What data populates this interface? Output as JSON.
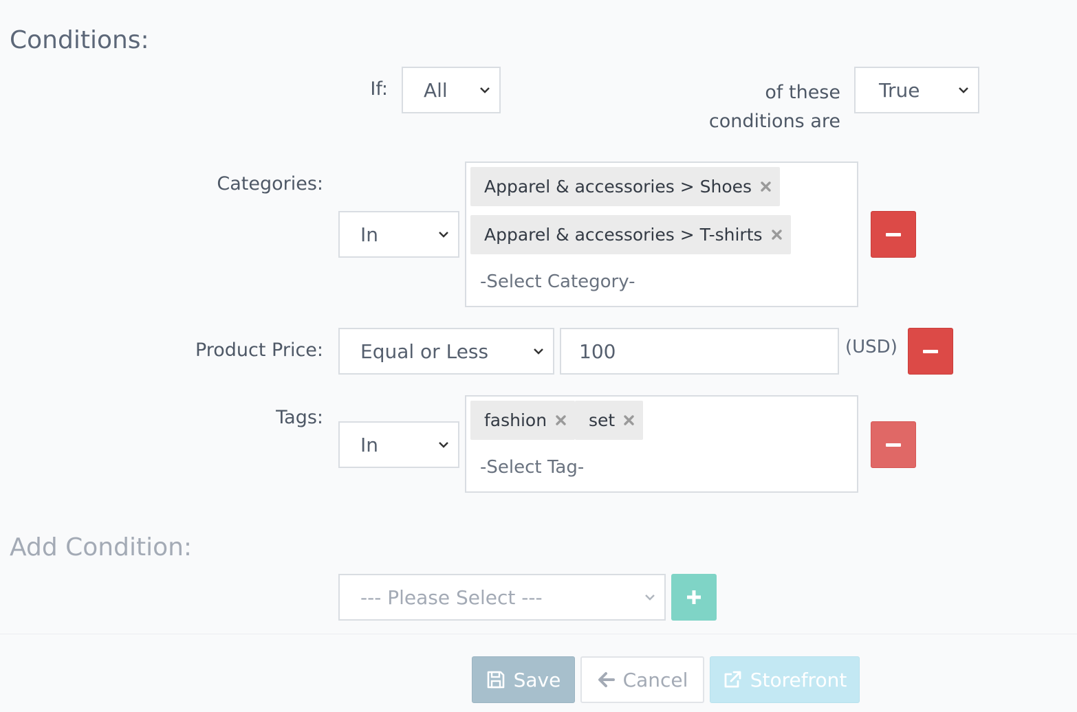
{
  "conditions_heading": "Conditions:",
  "if_row": {
    "if_label": "If:",
    "match_value": "All",
    "of_these_line1": "of these",
    "of_these_line2": "conditions are",
    "truth_value": "True"
  },
  "categories": {
    "label": "Categories:",
    "operator": "In",
    "chips": [
      "Apparel & accessories > Shoes",
      "Apparel & accessories > T-shirts"
    ],
    "placeholder": "-Select Category-"
  },
  "product_price": {
    "label": "Product Price:",
    "operator": "Equal or Less",
    "value": "100",
    "currency": "(USD)"
  },
  "tags": {
    "label": "Tags:",
    "operator": "In",
    "chips": [
      "fashion",
      "set"
    ],
    "placeholder": "-Select Tag-"
  },
  "add_condition": {
    "heading": "Add Condition:",
    "placeholder": "--- Please Select ---"
  },
  "actions": {
    "save": "Save",
    "cancel": "Cancel",
    "storefront": "Storefront"
  },
  "icons": {
    "remove": "minus-icon",
    "add": "plus-icon",
    "chip_remove": "times-icon",
    "save": "floppy-disk-icon",
    "cancel": "arrow-left-icon",
    "storefront": "external-link-icon",
    "dropdown": "chevron-down-icon"
  },
  "colors": {
    "danger": "#dc4a47",
    "success": "#7fd4c6",
    "save_button": "#a7bfcc",
    "storefront_button": "#c3e8f3"
  }
}
